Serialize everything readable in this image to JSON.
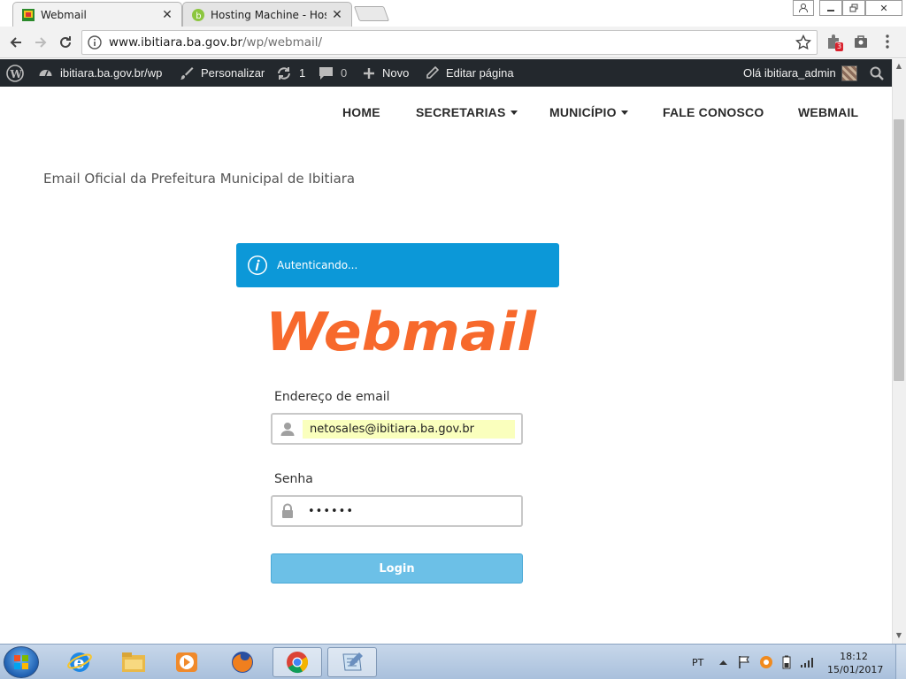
{
  "browser": {
    "tabs": [
      {
        "title": "Webmail",
        "active": true
      },
      {
        "title": "Hosting Machine - Hospe",
        "active": false
      }
    ],
    "url": {
      "host": "www.ibitiara.ba.gov.br",
      "path": "/wp/webmail/"
    },
    "extension_badge": "3",
    "window_controls": {
      "user": "user-icon",
      "minimize": "minimize-icon",
      "restore": "restore-icon",
      "close": "✕"
    }
  },
  "adminbar": {
    "site": "ibitiara.ba.gov.br/wp",
    "customize": "Personalizar",
    "updates_count": "1",
    "comments_count": "0",
    "new": "Novo",
    "edit": "Editar página",
    "greeting": "Olá ibitiara_admin"
  },
  "nav": {
    "items": [
      "HOME",
      "SECRETARIAS",
      "MUNICÍPIO",
      "FALE CONOSCO",
      "WEBMAIL"
    ]
  },
  "page": {
    "subtitle": "Email Oficial da Prefeitura Municipal de Ibitiara",
    "alert": "Autenticando...",
    "logo_text": "Webmail",
    "email_label": "Endereço de email",
    "email_value": "netosales@ibitiara.ba.gov.br",
    "password_label": "Senha",
    "password_value": "••••••",
    "login_label": "Login"
  },
  "taskbar": {
    "language": "PT",
    "time": "18:12",
    "date": "15/01/2017"
  },
  "colors": {
    "admin_bar": "#23282d",
    "alert_blue": "#0c98d8",
    "logo_orange": "#f7692c",
    "login_button": "#6cc0e7",
    "autofill": "#faffbd"
  }
}
